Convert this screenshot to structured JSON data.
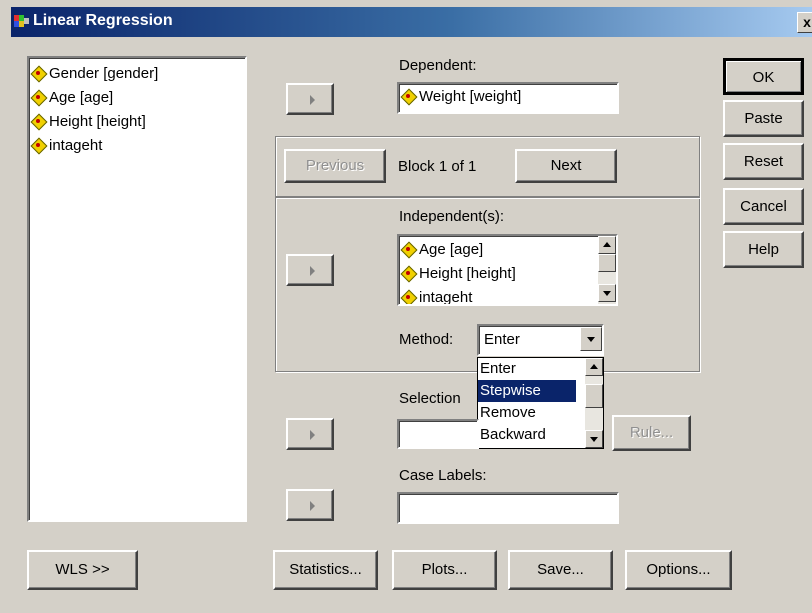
{
  "window": {
    "title": "Linear Regression",
    "close_glyph": "x"
  },
  "variables": [
    {
      "label": "Gender [gender]",
      "icon": "variable-icon"
    },
    {
      "label": "Age [age]",
      "icon": "variable-icon"
    },
    {
      "label": "Height [height]",
      "icon": "variable-icon"
    },
    {
      "label": "intageht",
      "icon": "variable-icon"
    }
  ],
  "dependent": {
    "label": "Dependent:",
    "value": "Weight [weight]"
  },
  "block": {
    "previous": "Previous",
    "text": "Block 1 of 1",
    "next": "Next"
  },
  "independents": {
    "label": "Independent(s):",
    "items": [
      "Age [age]",
      "Height [height]",
      "intageht"
    ]
  },
  "method": {
    "label": "Method:",
    "selected": "Enter",
    "options": [
      "Enter",
      "Stepwise",
      "Remove",
      "Backward"
    ],
    "highlighted": "Stepwise"
  },
  "selection": {
    "label": "Selection",
    "rule_button": "Rule..."
  },
  "case_labels": {
    "label": "Case Labels:",
    "value": ""
  },
  "side_buttons": {
    "ok": "OK",
    "paste": "Paste",
    "reset": "Reset",
    "cancel": "Cancel",
    "help": "Help"
  },
  "bottom_buttons": {
    "wls": "WLS >>",
    "statistics": "Statistics...",
    "plots": "Plots...",
    "save": "Save...",
    "options": "Options..."
  },
  "colors": {
    "titlebar": "#0a246a",
    "face": "#d4d0c8",
    "highlight": "#0a246a"
  }
}
